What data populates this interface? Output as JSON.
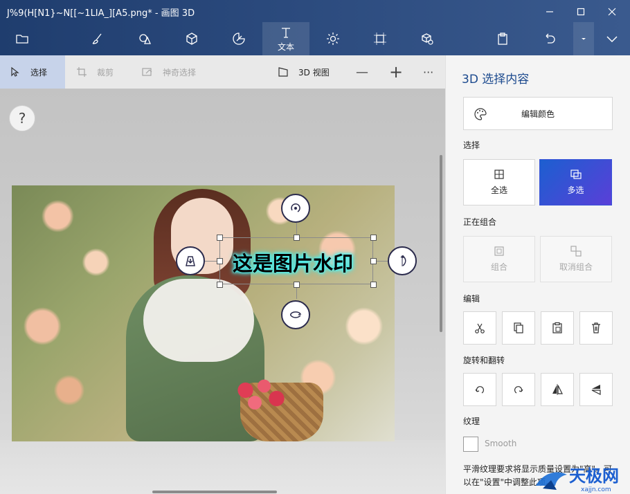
{
  "window": {
    "title": "J%9(H[N1}~N[[~1LIA_][A5.png* - 画图 3D",
    "controls": [
      "minimize",
      "maximize",
      "close"
    ]
  },
  "toolbar": {
    "active_label": "文本",
    "items": [
      "folder-icon",
      "brush-icon",
      "2d-shapes-icon",
      "3d-shapes-icon",
      "stickers-icon",
      "text-icon",
      "effects-icon",
      "canvas-icon",
      "3d-library-icon",
      "paste-icon",
      "undo-icon",
      "history-dropdown-icon",
      "collapse-icon"
    ]
  },
  "subtoolbar": {
    "select": "选择",
    "crop": "裁剪",
    "magic_select": "神奇选择",
    "view_3d": "3D 视图",
    "zoom_out": "—",
    "zoom_in": "+",
    "more": "···"
  },
  "canvas": {
    "help": "?",
    "watermark_text": "这是图片水印"
  },
  "panel": {
    "title": "3D 选择内容",
    "edit_color": "编辑颜色",
    "select_section": "选择",
    "select_all": "全选",
    "multi_select": "多选",
    "grouping_section": "正在组合",
    "group": "组合",
    "ungroup": "取消组合",
    "edit_section": "编辑",
    "rotate_section": "旋转和翻转",
    "texture_section": "纹理",
    "smooth_label": "Smooth",
    "note": "平滑纹理要求将显示质量设置为\"高\"。可以在\"设置\"中调整此项。",
    "logo_text": "天极网",
    "logo_url": "xajjn.com"
  },
  "colors": {
    "accent": "#1c5fd0",
    "title_bar": "#1f3d6e",
    "watermark_glow": "#4ff3f3"
  }
}
